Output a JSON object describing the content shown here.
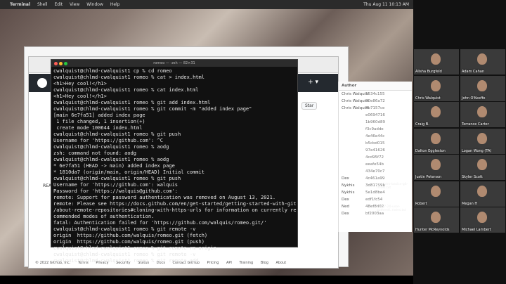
{
  "menubar": {
    "app": "Terminal",
    "items": [
      "Shell",
      "Edit",
      "View",
      "Window",
      "Help"
    ],
    "clock": "Thu Aug 11 10:13 AM"
  },
  "browser": {
    "github_star": "Star",
    "readme_label": "README",
    "footer": [
      "© 2022 GitHub, Inc.",
      "Terms",
      "Privacy",
      "Security",
      "Status",
      "Docs",
      "Contact GitHub",
      "Pricing",
      "API",
      "Training",
      "Blog",
      "About"
    ]
  },
  "terminal": {
    "title": "romeo — -zsh — 82×31",
    "lines": [
      "cwalquist@chlmd-cwalquist1 cp % cd romeo",
      "cwalquist@chlmd-cwalquist1 romeo % cat > index.html",
      "<h1>Hey cool!</h1>",
      "cwalquist@chlmd-cwalquist1 romeo % cat index.html",
      "<h1>Hey cool!</h1>",
      "cwalquist@chlmd-cwalquist1 romeo % git add index.html",
      "cwalquist@chlmd-cwalquist1 romeo % git commit -m \"added index page\"",
      "[main 6e7fa51] added index page",
      " 1 file changed, 1 insertion(+)",
      " create mode 100644 index.html",
      "cwalquist@chlmd-cwalquist1 romeo % git push",
      "Username for 'https://github.com': ^C",
      "cwalquist@chlmd-cwalquist1 romeo % aodg",
      "zsh: command not found: aodg",
      "cwalquist@chlmd-cwalquist1 romeo % aodg",
      "* 6e7fa51 (HEAD -> main) added index page",
      "* 1810da7 (origin/main, origin/HEAD) Initial commit",
      "cwalquist@chlmd-cwalquist1 romeo % git push",
      "Username for 'https://github.com': walquis",
      "Password for 'https://walquis@github.com':",
      "remote: Support for password authentication was removed on August 13, 2021.",
      "remote: Please see https://docs.github.com/en/get-started/getting-started-with-git",
      "/about-remote-repositories#cloning-with-https-urls for information on currently re",
      "commended modes of authentication.",
      "fatal: Authentication failed for 'https://github.com/walquis/romeo.git/'",
      "cwalquist@chlmd-cwalquist1 romeo % git remote -v",
      "origin  https://github.com/walquis/romeo.git (fetch)",
      "origin  https://github.com/walquis/romeo.git (push)",
      "cwalquist@chlmd-cwalquist1 romeo % git remote rm origin",
      "cwalquist@chlmd-cwalquist1 romeo % git remote -v",
      "cwalquist@chlmd-cwalquist1 romeo % git remote add"
    ]
  },
  "commits": {
    "header": "Author",
    "rows": [
      {
        "author": "Chris Walquist",
        "hash": "1534c155"
      },
      {
        "author": "Chris Walquist",
        "hash": "00e86a72"
      },
      {
        "author": "Chris Walquist",
        "hash": "8b7157ce"
      },
      {
        "author": "",
        "hash": "e0694716"
      },
      {
        "author": "",
        "hash": "1b960d89"
      },
      {
        "author": "",
        "hash": "f3c9adde"
      },
      {
        "author": "",
        "hash": "4e46e44c"
      },
      {
        "author": "",
        "hash": "b5cbd015"
      },
      {
        "author": "",
        "hash": "97e41626"
      },
      {
        "author": "",
        "hash": "4cd95f72"
      },
      {
        "author": "",
        "hash": "eeafe54b"
      },
      {
        "author": "",
        "hash": "434e70c7"
      },
      {
        "author": "Dex",
        "hash": "4c461a99"
      },
      {
        "author": "Nykhis",
        "hash": "3d81759b"
      },
      {
        "author": "Nykhis",
        "hash": "5e1d8be4"
      },
      {
        "author": "Dex",
        "hash": "edf1fc54"
      },
      {
        "author": "Ned",
        "hash": "48ef8d02"
      },
      {
        "author": "Dex",
        "hash": "bf2003aa"
      }
    ]
  },
  "desktop_files": [
    "ppt-intro-basics-git-notes.txt",
    "22-07-20-user-authenti..notes.txt"
  ],
  "participants": [
    {
      "name": "Alisha Burgfeld"
    },
    {
      "name": "Adam Cahan"
    },
    {
      "name": "Chris Walquist"
    },
    {
      "name": "John O'Keeffe"
    },
    {
      "name": "Craig B."
    },
    {
      "name": "Terrance Carter"
    },
    {
      "name": "Dalton Eggleston"
    },
    {
      "name": "Logan Wong (TA)"
    },
    {
      "name": "Justin Peterson"
    },
    {
      "name": "Skyler Scott"
    },
    {
      "name": "Robert"
    },
    {
      "name": "Megan H"
    },
    {
      "name": "Hunter McReynolds"
    },
    {
      "name": "Michael Lambert"
    }
  ]
}
